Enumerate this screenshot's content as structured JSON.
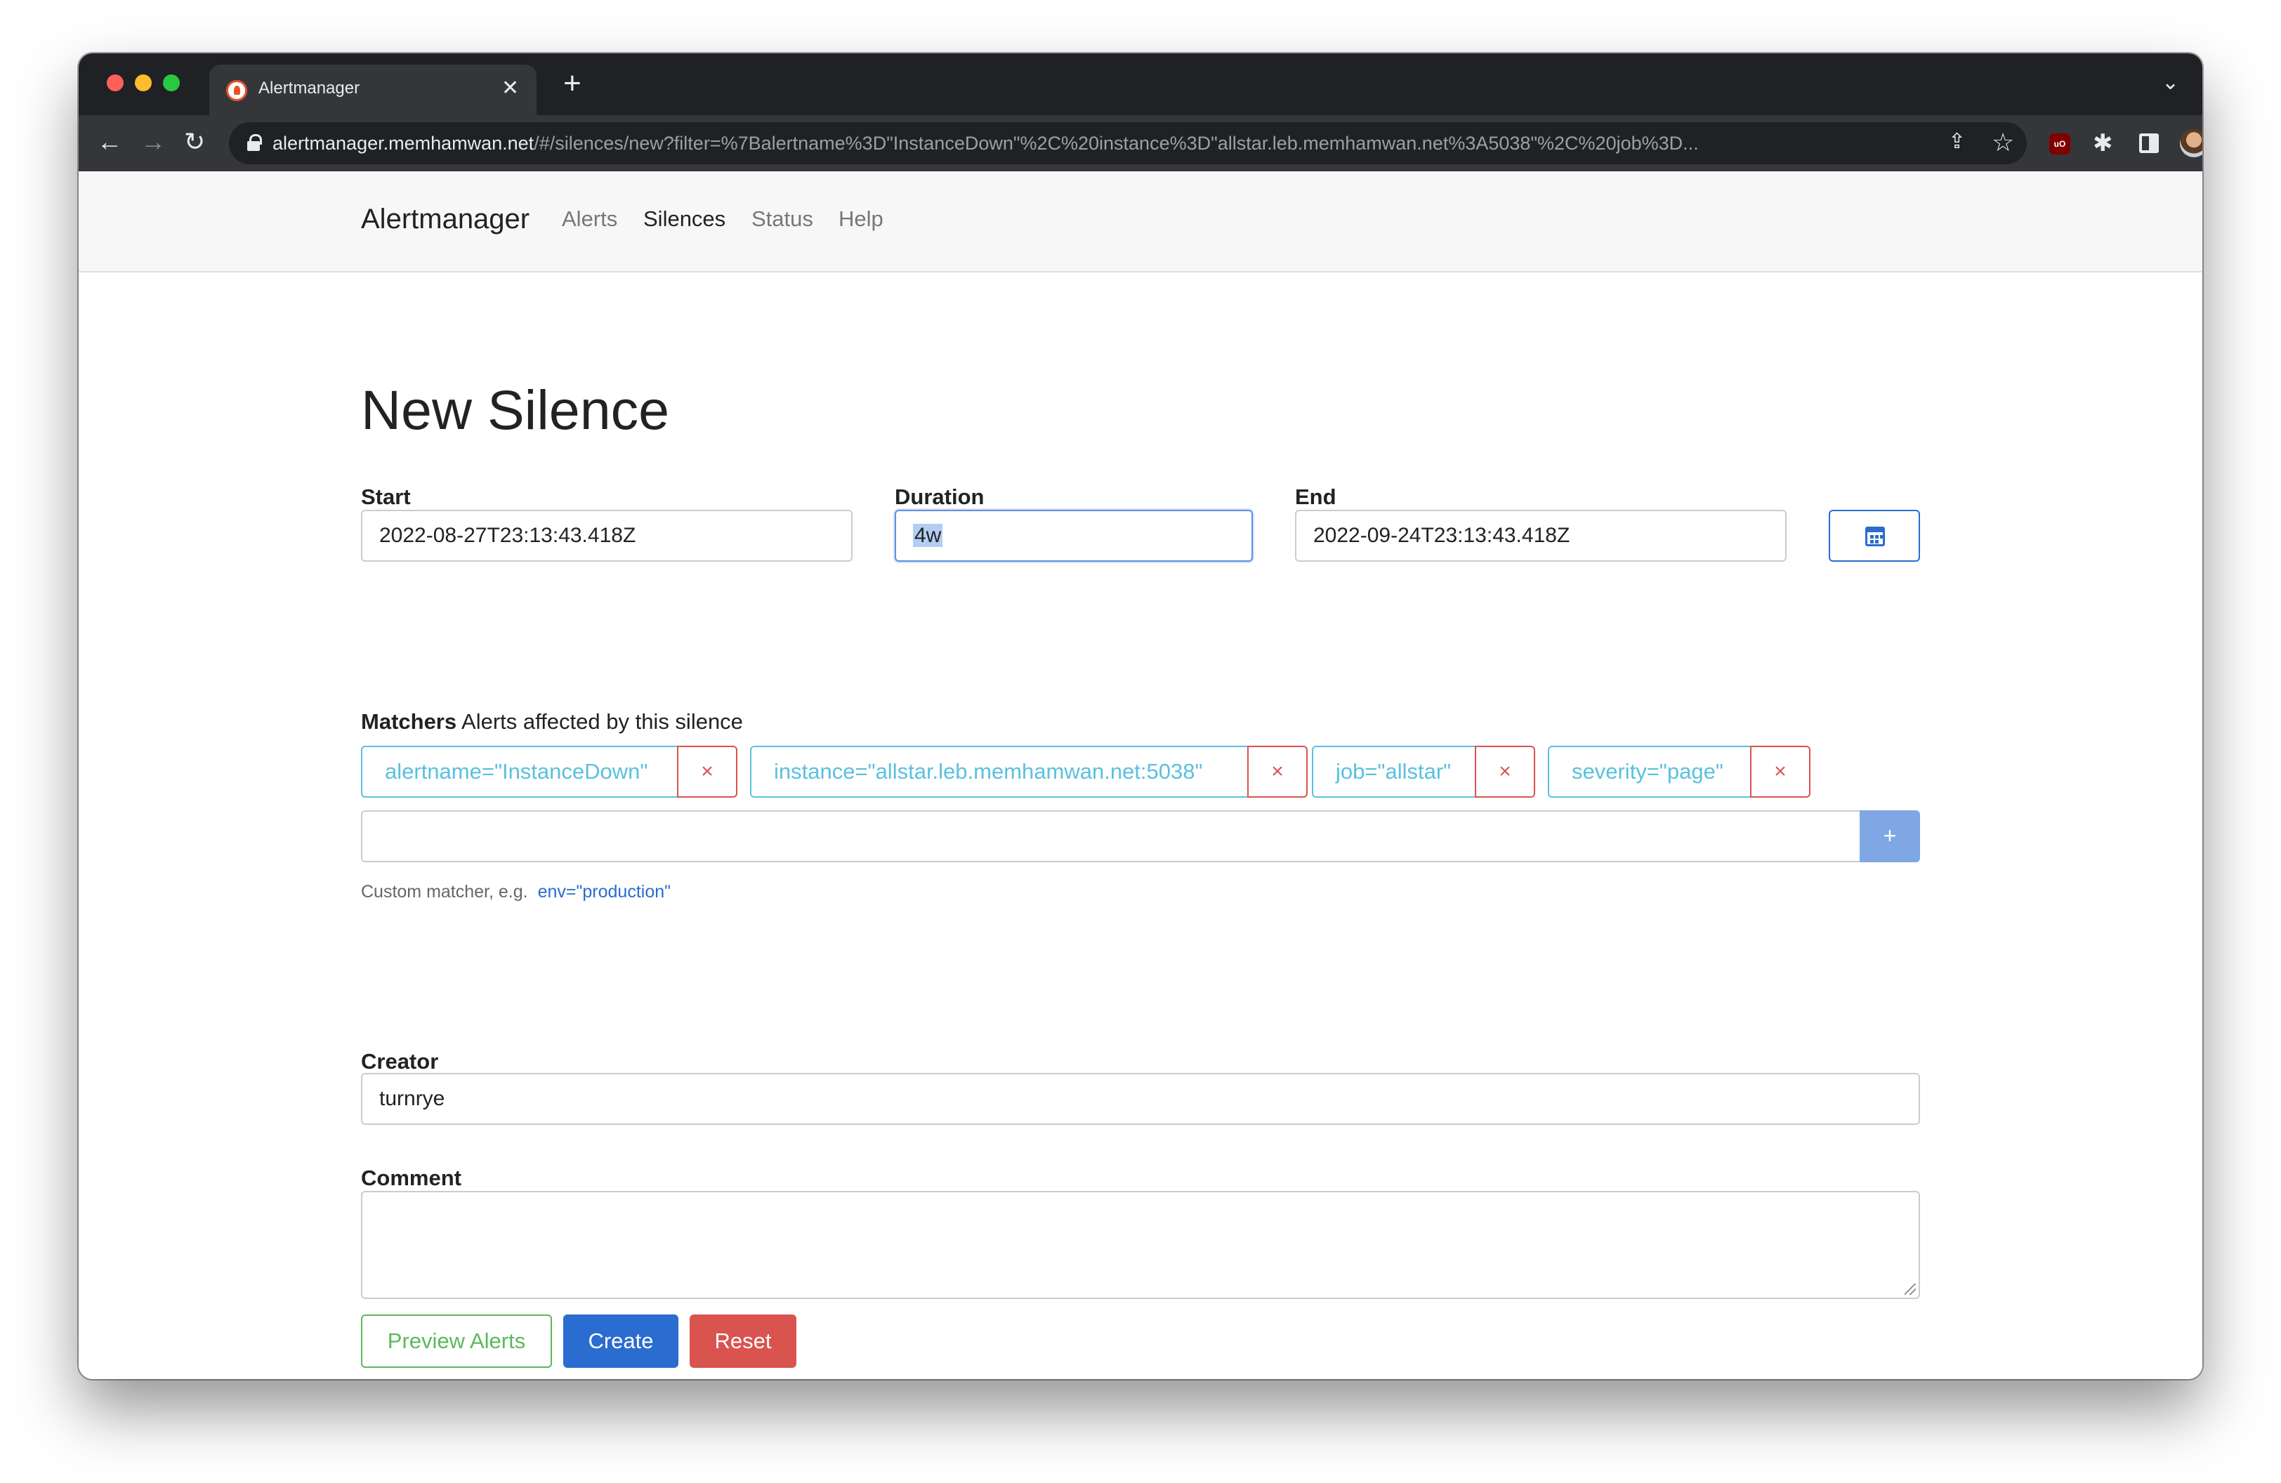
{
  "browser": {
    "tab_title": "Alertmanager",
    "url_host": "alertmanager.memhamwan.net",
    "url_path": "/#/silences/new?filter=%7Balertname%3D\"InstanceDown\"%2C%20instance%3D\"allstar.leb.memhamwan.net%3A5038\"%2C%20job%3D..."
  },
  "navbar": {
    "brand": "Alertmanager",
    "links": [
      "Alerts",
      "Silences",
      "Status",
      "Help"
    ],
    "active": "Silences"
  },
  "form": {
    "title": "New Silence",
    "start": {
      "label": "Start",
      "value": "2022-08-27T23:13:43.418Z"
    },
    "duration": {
      "label": "Duration",
      "value": "4w"
    },
    "end": {
      "label": "End",
      "value": "2022-09-24T23:13:43.418Z"
    },
    "matchers": {
      "label": "Matchers",
      "description": "Alerts affected by this silence",
      "items": [
        "alertname=\"InstanceDown\"",
        "instance=\"allstar.leb.memhamwan.net:5038\"",
        "job=\"allstar\"",
        "severity=\"page\""
      ],
      "remove_glyph": "×",
      "new_value": "",
      "add_glyph": "+",
      "help_text": "Custom matcher, e.g.",
      "help_example": "env=\"production\""
    },
    "creator": {
      "label": "Creator",
      "value": "turnrye"
    },
    "comment": {
      "label": "Comment",
      "value": ""
    },
    "buttons": {
      "preview": "Preview Alerts",
      "create": "Create",
      "reset": "Reset"
    }
  },
  "colors": {
    "primary": "#2a6ccf",
    "info": "#5bc0de",
    "danger": "#d9534f",
    "success": "#5cb85c"
  }
}
